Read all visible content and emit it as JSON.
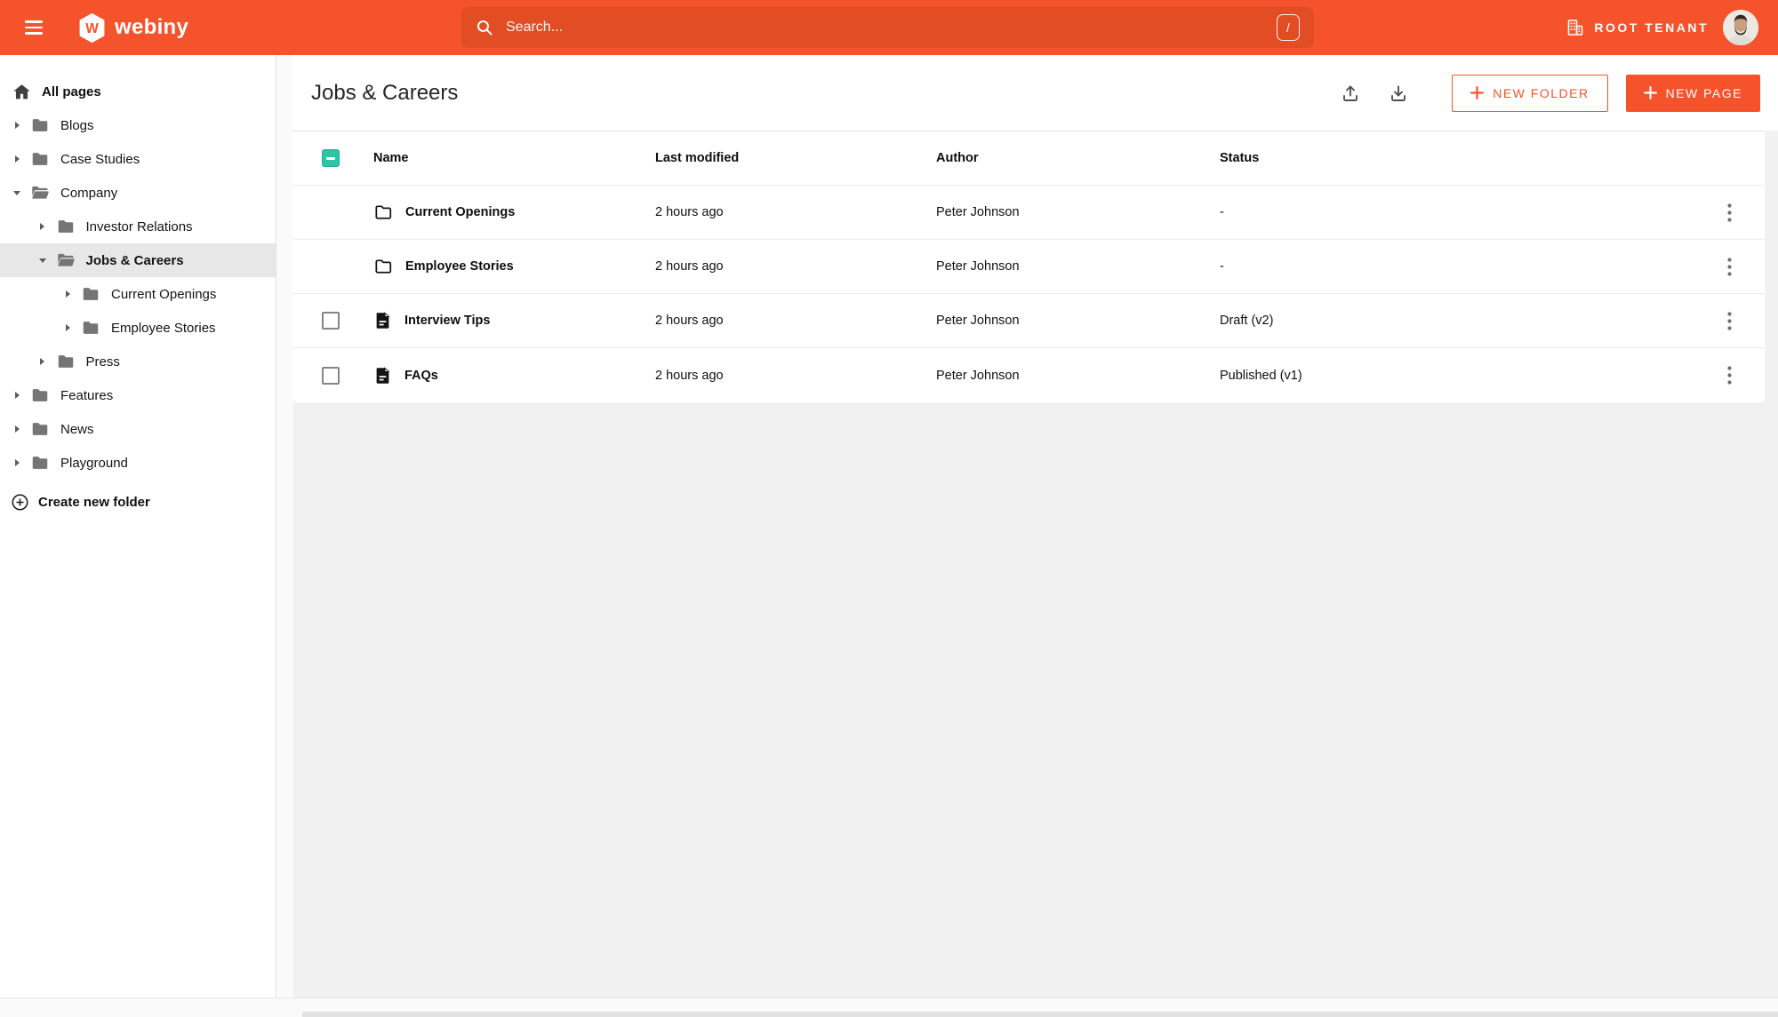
{
  "colors": {
    "brand_orange": "#F4532B",
    "search_bg": "#E24D24",
    "checkbox_teal": "#2EC4A6"
  },
  "topbar": {
    "brand": "webiny",
    "search": {
      "placeholder": "Search...",
      "shortcut": "/"
    },
    "tenant_label": "ROOT TENANT"
  },
  "sidebar": {
    "root_label": "All pages",
    "tree": [
      {
        "label": "Blogs",
        "depth": 0,
        "caret": "right",
        "folder": "closed",
        "selected": false
      },
      {
        "label": "Case Studies",
        "depth": 0,
        "caret": "right",
        "folder": "closed",
        "selected": false
      },
      {
        "label": "Company",
        "depth": 0,
        "caret": "down",
        "folder": "open",
        "selected": false
      },
      {
        "label": "Investor Relations",
        "depth": 1,
        "caret": "right",
        "folder": "closed",
        "selected": false
      },
      {
        "label": "Jobs & Careers",
        "depth": 1,
        "caret": "down",
        "folder": "open",
        "selected": true
      },
      {
        "label": "Current Openings",
        "depth": 2,
        "caret": "right",
        "folder": "closed",
        "selected": false
      },
      {
        "label": "Employee Stories",
        "depth": 2,
        "caret": "right",
        "folder": "closed",
        "selected": false
      },
      {
        "label": "Press",
        "depth": 1,
        "caret": "right",
        "folder": "closed",
        "selected": false
      },
      {
        "label": "Features",
        "depth": 0,
        "caret": "right",
        "folder": "closed",
        "selected": false
      },
      {
        "label": "News",
        "depth": 0,
        "caret": "right",
        "folder": "closed",
        "selected": false
      },
      {
        "label": "Playground",
        "depth": 0,
        "caret": "right",
        "folder": "closed",
        "selected": false
      }
    ],
    "create_folder_label": "Create new folder"
  },
  "main": {
    "title": "Jobs & Careers",
    "actions": {
      "new_folder": "NEW FOLDER",
      "new_page": "NEW PAGE"
    },
    "table": {
      "select_all_state": "indeterminate",
      "columns": {
        "name": "Name",
        "last_modified": "Last modified",
        "author": "Author",
        "status": "Status"
      },
      "rows": [
        {
          "type": "folder",
          "name": "Current Openings",
          "last_modified": "2 hours ago",
          "author": "Peter Johnson",
          "status": "-",
          "has_checkbox": false,
          "checked": false
        },
        {
          "type": "folder",
          "name": "Employee Stories",
          "last_modified": "2 hours ago",
          "author": "Peter Johnson",
          "status": "-",
          "has_checkbox": false,
          "checked": false
        },
        {
          "type": "page",
          "name": "Interview Tips",
          "last_modified": "2 hours ago",
          "author": "Peter Johnson",
          "status": "Draft (v2)",
          "has_checkbox": true,
          "checked": false
        },
        {
          "type": "page",
          "name": "FAQs",
          "last_modified": "2 hours ago",
          "author": "Peter Johnson",
          "status": "Published (v1)",
          "has_checkbox": true,
          "checked": false
        }
      ]
    }
  }
}
